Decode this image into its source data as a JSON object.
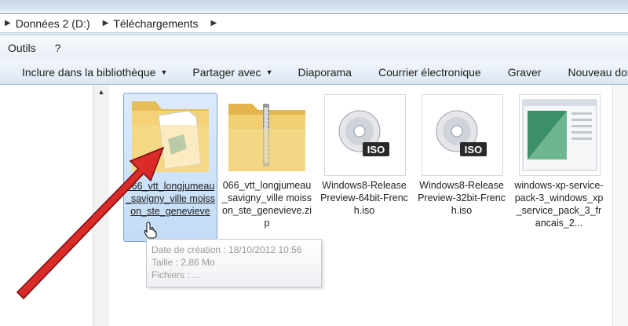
{
  "address": {
    "crumbs": [
      "Données 2 (D:)",
      "Téléchargements"
    ]
  },
  "menu": {
    "items": [
      "Outils",
      "?"
    ]
  },
  "toolbar": {
    "include": "Inclure dans la bibliothèque",
    "share": "Partager avec",
    "slideshow": "Diaporama",
    "email": "Courrier électronique",
    "burn": "Graver",
    "newfolder": "Nouveau dossi"
  },
  "files": [
    {
      "name": "066_vtt_longjumeau_savigny_ville moisson_ste_genevieve",
      "icon": "folder-with-document-icon",
      "selected": true
    },
    {
      "name": "066_vtt_longjumeau_savigny_ville moisson_ste_genevieve.zip",
      "icon": "zip-folder-icon",
      "selected": false
    },
    {
      "name": "Windows8-ReleasePreview-64bit-French.iso",
      "icon": "iso-disc-icon",
      "selected": false
    },
    {
      "name": "Windows8-ReleasePreview-32bit-French.iso",
      "icon": "iso-disc-icon",
      "selected": false
    },
    {
      "name": "windows-xp-service-pack-3_windows_xp_service_pack_3_francais_2...",
      "icon": "document-thumbnail-icon",
      "selected": false
    }
  ],
  "iso_label": "ISO",
  "tooltip": {
    "created": "Date de création : 18/10/2012 10:56",
    "size": "Taille : 2,86 Mo",
    "files": "Fichiers : ..."
  },
  "colors": {
    "selection": "#c3dcf7",
    "arrow": "#d0161b",
    "folder": "#f3d27a"
  }
}
